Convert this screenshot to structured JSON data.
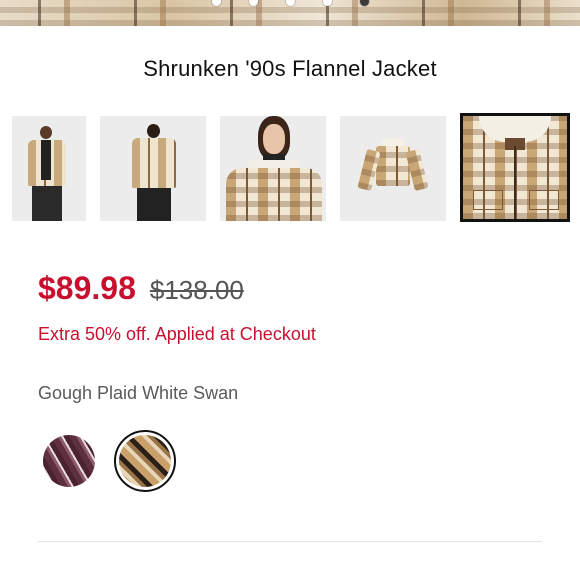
{
  "hero": {
    "dots_count": 5,
    "active_dot": 4
  },
  "product": {
    "title": "Shrunken '90s Flannel Jacket",
    "sale_price": "$89.98",
    "original_price": "$138.00",
    "promo": "Extra 50% off. Applied at Checkout",
    "color_name": "Gough Plaid White Swan"
  },
  "thumbnails": [
    {
      "name": "front-view"
    },
    {
      "name": "back-view"
    },
    {
      "name": "closeup-view"
    },
    {
      "name": "flat-lay-view"
    },
    {
      "name": "collar-detail-view",
      "selected": true
    }
  ],
  "swatches": [
    {
      "name": "purple-plaid",
      "selected": false
    },
    {
      "name": "gough-plaid-white-swan",
      "selected": true
    }
  ],
  "colors": {
    "sale": "#c8102e",
    "text": "#111111",
    "muted": "#5a5a5a"
  }
}
